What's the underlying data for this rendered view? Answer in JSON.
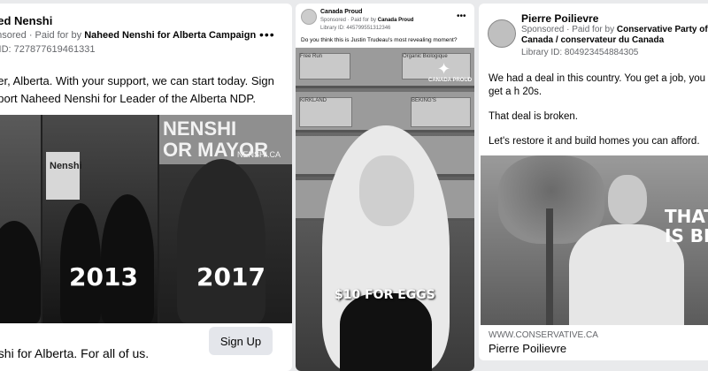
{
  "ad1": {
    "advertiser_partial": "eed Nenshi",
    "sponsored_partial": "onsored",
    "paid_by_prefix": "Paid for by",
    "paid_by": "Naheed Nenshi for Alberta Campaign",
    "library_id_partial": "y ID: 727877619461331",
    "text_line1": "tter, Alberta. With your support, we can start today. Sign",
    "text_line2": "pport Naheed Nenshi for Leader of the Alberta NDP.",
    "media": {
      "sign_text": "Nenshi",
      "banner_text_line1": "NENSHI",
      "banner_text_line2": "OR MAYOR",
      "banner_url": "NENSHI.CA",
      "year1": "2013",
      "year2": "2017"
    },
    "footer_partial": "nshi for Alberta. For all of us.",
    "cta_label": "Sign Up",
    "more_icon": "ellipsis-icon"
  },
  "ad2": {
    "advertiser": "Canada Proud",
    "sponsored": "Sponsored",
    "paid_by_prefix": "Paid for by",
    "paid_by": "Canada Proud",
    "library_id": "Library ID: 445799551312346",
    "question": "Do you think this is Justin Trudeau's most revealing moment?",
    "media": {
      "logo_text": "CANADA PROUD",
      "caption": "$10 FOR EGGS",
      "cartons": [
        "Free Run",
        "Organic Biologique",
        "KIRKLAND",
        "BEKING'S"
      ]
    },
    "more_icon": "ellipsis-icon"
  },
  "ad3": {
    "advertiser": "Pierre Poilievre",
    "sponsored": "Sponsored",
    "paid_by_prefix": "Paid for by",
    "paid_by": "Conservative Party of Canada / conservateur du Canada",
    "library_id": "Library ID: 804923454884305",
    "paragraph1": "We had a deal in this country. You get a job, you get a h 20s.",
    "paragraph2": "That deal is broken.",
    "paragraph3": "Let's restore it and build homes you can afford.",
    "media": {
      "overlay_line1": "THAT",
      "overlay_line2": "IS BR"
    },
    "link_url": "WWW.CONSERVATIVE.CA",
    "link_title": "Pierre Poilievre"
  }
}
